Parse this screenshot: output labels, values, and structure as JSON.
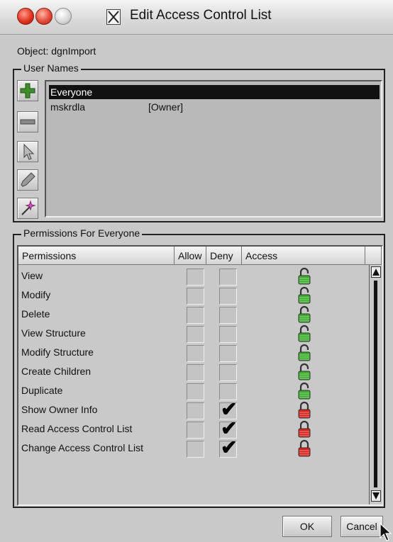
{
  "window": {
    "title": "Edit Access Control List"
  },
  "object": {
    "label": "Object: dgnImport"
  },
  "users": {
    "legend": "User Names",
    "tools": [
      {
        "name": "add-user-icon"
      },
      {
        "name": "remove-user-icon"
      },
      {
        "name": "select-pointer-icon"
      },
      {
        "name": "eyedropper-icon"
      },
      {
        "name": "magic-wand-icon"
      }
    ],
    "rows": [
      {
        "name": "Everyone",
        "role": ""
      },
      {
        "name": "mskrdla",
        "role": "[Owner]"
      }
    ]
  },
  "permissions": {
    "legend": "Permissions For Everyone",
    "headers": {
      "permissions": "Permissions",
      "allow": "Allow",
      "deny": "Deny",
      "access": "Access"
    },
    "rows": [
      {
        "label": "View",
        "allow": false,
        "deny": false,
        "access": "unlocked-green"
      },
      {
        "label": "Modify",
        "allow": false,
        "deny": false,
        "access": "unlocked-green"
      },
      {
        "label": "Delete",
        "allow": false,
        "deny": false,
        "access": "unlocked-green"
      },
      {
        "label": "View Structure",
        "allow": false,
        "deny": false,
        "access": "unlocked-green"
      },
      {
        "label": "Modify Structure",
        "allow": false,
        "deny": false,
        "access": "unlocked-green"
      },
      {
        "label": "Create Children",
        "allow": false,
        "deny": false,
        "access": "unlocked-green"
      },
      {
        "label": "Duplicate",
        "allow": false,
        "deny": false,
        "access": "unlocked-green"
      },
      {
        "label": "Show Owner Info",
        "allow": false,
        "deny": true,
        "access": "locked-red"
      },
      {
        "label": "Read Access Control List",
        "allow": false,
        "deny": true,
        "access": "locked-red"
      },
      {
        "label": "Change Access Control List",
        "allow": false,
        "deny": true,
        "access": "locked-red"
      }
    ]
  },
  "buttons": {
    "ok": "OK",
    "cancel": "Cancel"
  },
  "colors": {
    "unlocked": "#3cae2c",
    "locked": "#d8241c",
    "selection": "#111111"
  }
}
